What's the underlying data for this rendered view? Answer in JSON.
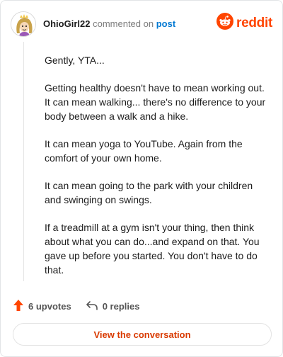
{
  "header": {
    "username": "OhioGirl22",
    "commented_text": "commented on",
    "post_link": "post",
    "brand": "reddit"
  },
  "comment": {
    "paragraphs": [
      "Gently, YTA...",
      "Getting healthy doesn't have to mean working out. It can mean walking... there's no difference to your body between a walk and a hike.",
      "It can mean yoga to YouTube. Again from the comfort of your own home.",
      "It can mean going to the park with your children and swinging on swings.",
      "If a treadmill at a gym isn't your thing, then think about what you can do...and expand on that. You gave up before you started. You don't have to do that."
    ]
  },
  "actions": {
    "upvotes": "6 upvotes",
    "replies": "0 replies"
  },
  "cta": {
    "label": "View the conversation"
  },
  "colors": {
    "brand": "#ff4500",
    "link": "#0079d3",
    "upvote": "#ff4500",
    "cta_text": "#d93a00"
  },
  "icons": [
    "avatar",
    "reddit-logo-icon",
    "upvote-arrow-icon",
    "reply-icon"
  ]
}
